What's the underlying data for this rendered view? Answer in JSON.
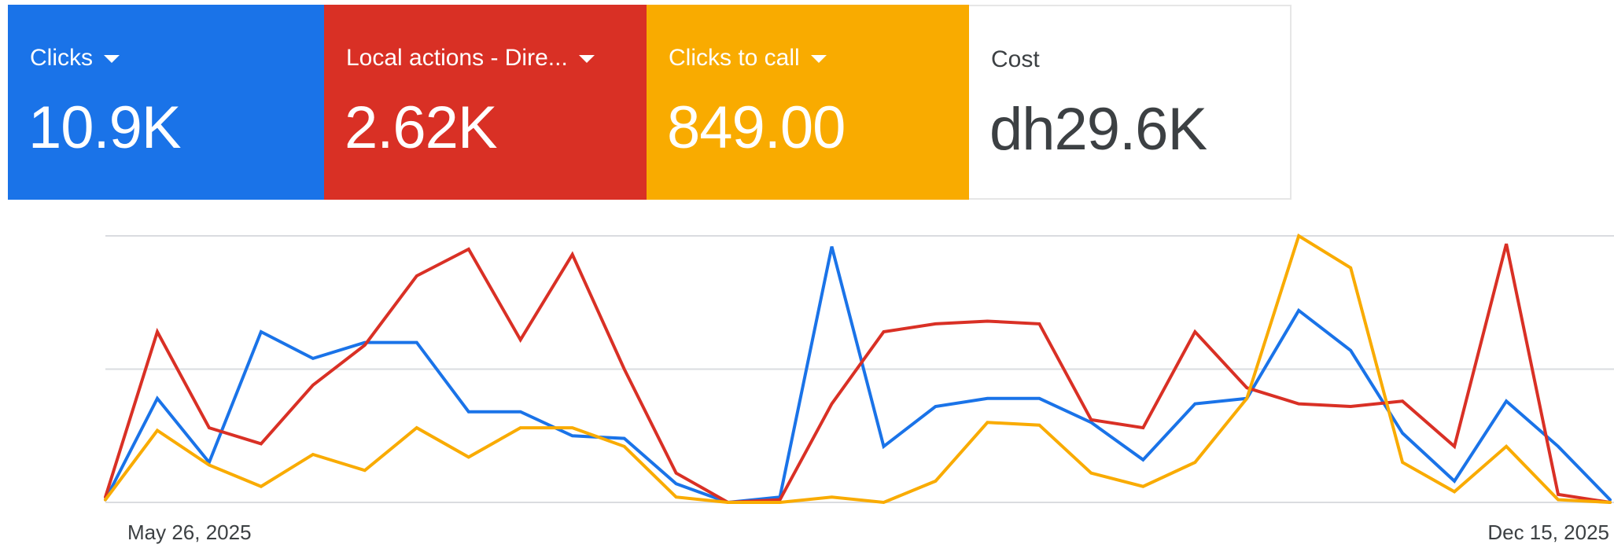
{
  "colors": {
    "clicks": "#1a73e8",
    "local_actions": "#d93025",
    "clicks_to_call": "#f9ab00",
    "cost_text": "#3c4043",
    "gridline": "#dadce0"
  },
  "scorecards": [
    {
      "label": "Clicks",
      "value": "10.9K",
      "has_dropdown": true,
      "dropdown_icon": "caret-down-icon"
    },
    {
      "label": "Local actions - Dire...",
      "value": "2.62K",
      "has_dropdown": true,
      "dropdown_icon": "caret-down-icon"
    },
    {
      "label": "Clicks to call",
      "value": "849.00",
      "has_dropdown": true,
      "dropdown_icon": "caret-down-icon"
    },
    {
      "label": "Cost",
      "value": "dh29.6K",
      "has_dropdown": false
    }
  ],
  "chart_data": {
    "type": "line",
    "title": "",
    "xlabel": "",
    "ylabel": "",
    "x_tick_labels": [
      "May 26, 2025",
      "Dec 15, 2025"
    ],
    "x": [
      "May 26, 2025",
      "Jun 2, 2025",
      "Jun 9, 2025",
      "Jun 16, 2025",
      "Jun 23, 2025",
      "Jun 30, 2025",
      "Jul 7, 2025",
      "Jul 14, 2025",
      "Jul 21, 2025",
      "Jul 28, 2025",
      "Aug 4, 2025",
      "Aug 11, 2025",
      "Aug 18, 2025",
      "Aug 25, 2025",
      "Sep 1, 2025",
      "Sep 8, 2025",
      "Sep 15, 2025",
      "Sep 22, 2025",
      "Sep 29, 2025",
      "Oct 6, 2025",
      "Oct 13, 2025",
      "Oct 20, 2025",
      "Oct 27, 2025",
      "Nov 3, 2025",
      "Nov 10, 2025",
      "Nov 17, 2025",
      "Nov 24, 2025",
      "Dec 1, 2025",
      "Dec 8, 2025",
      "Dec 15, 2025"
    ],
    "y_axis_visible": false,
    "gridlines": "horizontal",
    "ylim": [
      0,
      1
    ],
    "legend": "none",
    "series": [
      {
        "key": "clicks",
        "color": "#1a73e8",
        "values": [
          0.01,
          0.39,
          0.15,
          0.64,
          0.54,
          0.6,
          0.6,
          0.34,
          0.34,
          0.25,
          0.24,
          0.07,
          0.0,
          0.02,
          0.96,
          0.21,
          0.36,
          0.39,
          0.39,
          0.3,
          0.16,
          0.37,
          0.39,
          0.72,
          0.57,
          0.26,
          0.08,
          0.38,
          0.21,
          0.01
        ]
      },
      {
        "key": "local_actions",
        "color": "#d93025",
        "values": [
          0.02,
          0.64,
          0.28,
          0.22,
          0.44,
          0.59,
          0.85,
          0.95,
          0.61,
          0.93,
          0.5,
          0.11,
          0.0,
          0.01,
          0.37,
          0.64,
          0.67,
          0.68,
          0.67,
          0.31,
          0.28,
          0.64,
          0.43,
          0.37,
          0.36,
          0.38,
          0.21,
          0.97,
          0.03,
          0.0
        ]
      },
      {
        "key": "clicks_to_call",
        "color": "#f9ab00",
        "values": [
          0.01,
          0.27,
          0.14,
          0.06,
          0.18,
          0.12,
          0.28,
          0.17,
          0.28,
          0.28,
          0.21,
          0.02,
          0.0,
          0.0,
          0.02,
          0.0,
          0.08,
          0.3,
          0.29,
          0.11,
          0.06,
          0.15,
          0.39,
          1.0,
          0.88,
          0.15,
          0.04,
          0.21,
          0.01,
          0.0
        ]
      }
    ]
  }
}
